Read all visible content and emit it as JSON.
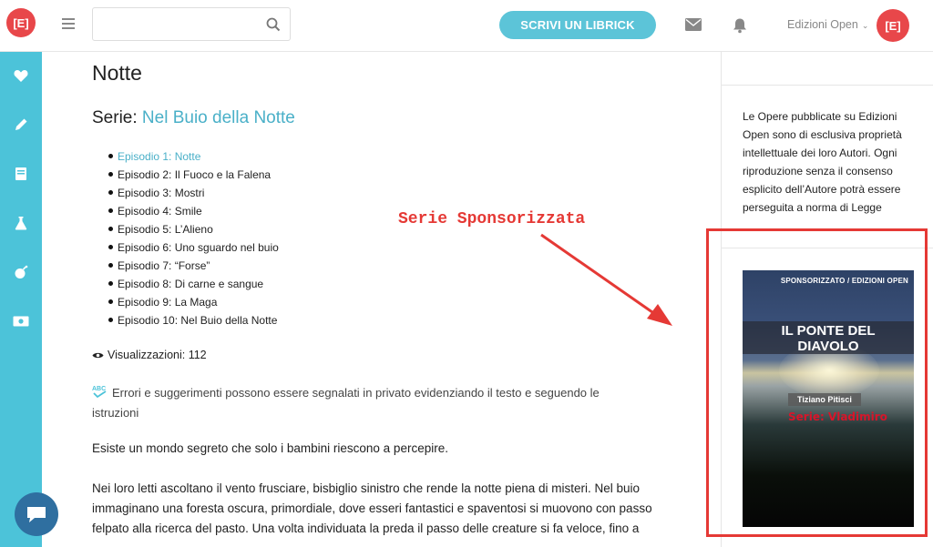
{
  "header": {
    "logo_text": "[E]",
    "search_placeholder": "",
    "cta_label": "SCRIVI UN LIBRICK",
    "user_name": "Edizioni Open",
    "user_chevron": "⌄",
    "avatar_text": "[E]"
  },
  "sidebar": {
    "items": [
      {
        "icon": "heart-icon"
      },
      {
        "icon": "pencil-icon"
      },
      {
        "icon": "book-icon"
      },
      {
        "icon": "flask-icon"
      },
      {
        "icon": "bomb-icon"
      },
      {
        "icon": "money-icon"
      }
    ],
    "chat_icon": "chat-bubble-icon"
  },
  "main": {
    "title": "Notte",
    "series_prefix": "Serie: ",
    "series_name": "Nel Buio della Notte",
    "episodes": [
      "Episodio 1: Notte",
      "Episodio 2: Il Fuoco e la Falena",
      "Episodio 3: Mostri",
      "Episodio 4: Smile",
      "Episodio 5: L’Alieno",
      "Episodio 6: Uno sguardo nel buio",
      "Episodio 7: “Forse”",
      "Episodio 8: Di carne e sangue",
      "Episodio 9: La Maga",
      "Episodio 10: Nel Buio della Notte"
    ],
    "views": "Visualizzazioni: 112",
    "note": "Errori e suggerimenti possono essere segnalati in privato evidenziando il testo e seguendo le istruzioni",
    "paragraph1": "Esiste un mondo segreto che solo i bambini riescono a percepire.",
    "paragraph2": "Nei loro letti ascoltano il vento frusciare, bisbiglio sinistro che rende la notte piena di misteri. Nel buio immaginano una foresta oscura, primordiale, dove esseri fantastici e spaventosi si muovono con passo felpato alla ricerca del pasto. Una volta individuata la preda il passo delle creature si fa veloce, fino a"
  },
  "annotation": {
    "label": "Serie Sponsorizzata",
    "color": "#e53935"
  },
  "right": {
    "copyright": "Le Opere pubblicate su Edizioni Open sono di esclusiva proprietà intellettuale dei loro Autori. Ogni riproduzione senza il consenso esplicito dell’Autore potrà essere perseguita a norma di Legge",
    "book": {
      "tag": "SPONSORIZZATO / EDIZIONI OPEN",
      "title_line1": "IL PONTE DEL",
      "title_line2": "DIAVOLO",
      "author": "Tiziano Pitisci",
      "series": "Serie: Vladimiro"
    }
  },
  "colors": {
    "accent": "#4cc3d9",
    "brand_red": "#e8474a",
    "link": "#4ab0c8"
  }
}
